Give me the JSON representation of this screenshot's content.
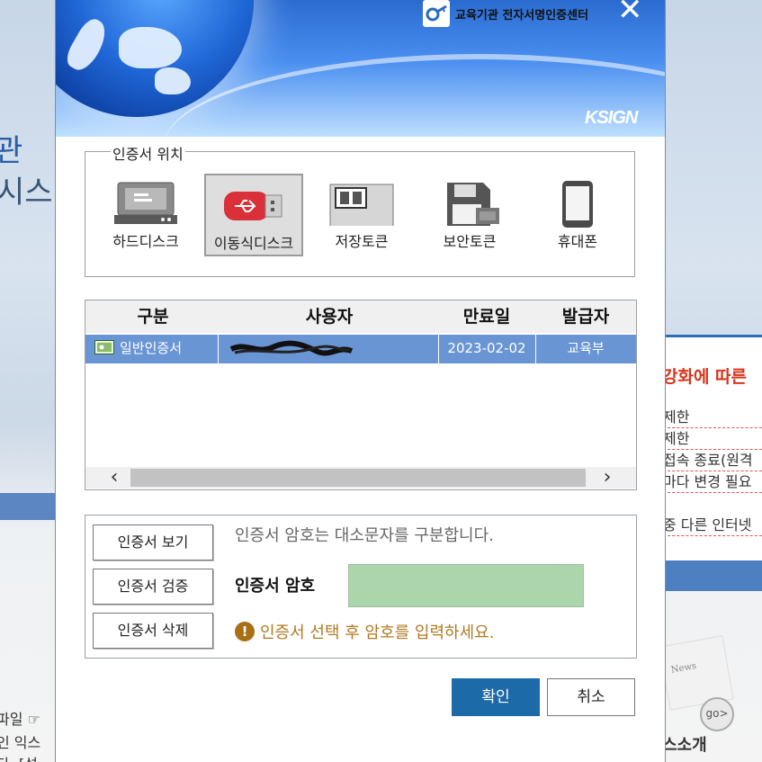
{
  "background": {
    "heading_fragment_1": "관",
    "heading_fragment_2": "시스",
    "right_panel_title": "강화에 따른",
    "right_panel_lines": [
      "제한",
      " 제한",
      "접속 종료(원격",
      "마다 변경 필요",
      "중 다른 인터넷"
    ],
    "bottom_lines": [
      "파일 ☞",
      "인 익스",
      "다. [설"
    ],
    "news_label": "News",
    "go_label": "go>",
    "intro_label": "스소개"
  },
  "dialog": {
    "banner_title": "교육기관 전자서명인증센터",
    "brand": "KSIGN",
    "close_glyph": "✕",
    "location": {
      "legend": "인증서 위치",
      "items": [
        {
          "label": "하드디스크",
          "icon": "hard-disk-icon",
          "selected": false
        },
        {
          "label": "이동식디스크",
          "icon": "usb-drive-icon",
          "selected": true
        },
        {
          "label": "저장토큰",
          "icon": "storage-token-icon",
          "selected": false
        },
        {
          "label": "보안토큰",
          "icon": "security-token-icon",
          "selected": false
        },
        {
          "label": "휴대폰",
          "icon": "mobile-phone-icon",
          "selected": false
        }
      ]
    },
    "cert_list": {
      "headers": [
        "구분",
        "사용자",
        "만료일",
        "발급자"
      ],
      "rows": [
        {
          "type": "일반인증서",
          "user": "[redacted]",
          "expiry": "2023-02-02",
          "issuer": "교육부"
        }
      ],
      "scroll_left": "‹",
      "scroll_right": "›"
    },
    "buttons": {
      "view": "인증서 보기",
      "verify": "인증서 검증",
      "delete": "인증서 삭제",
      "ok": "확인",
      "cancel": "취소"
    },
    "password": {
      "hint": "인증서 암호는 대소문자를 구분합니다.",
      "label": "인증서 암호",
      "value": "",
      "warning": "인증서 선택 후 암호를 입력하세요.",
      "warning_icon": "!"
    }
  },
  "colors": {
    "selected_row": "#6a95d4",
    "ok_button": "#1d6aa8",
    "password_field": "#acd5ac",
    "warning_text": "#b07a22"
  }
}
